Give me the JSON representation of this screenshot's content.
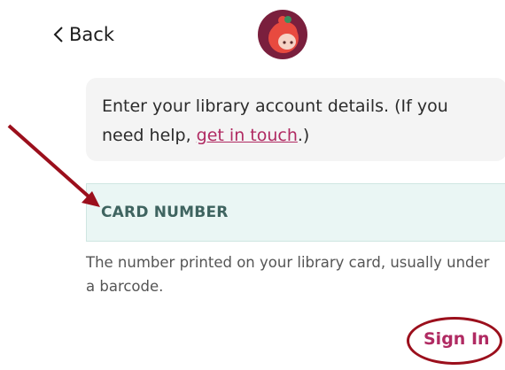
{
  "nav": {
    "back_label": "Back"
  },
  "icons": {
    "back": "chevron-left-icon",
    "logo": "libby-logo-icon"
  },
  "info": {
    "text_before": "Enter your library account details. (If you need help, ",
    "link_text": "get in touch",
    "text_after": ".)"
  },
  "form": {
    "card_number_label": "CARD NUMBER",
    "card_number_value": "",
    "hint": "The number printed on your library card, usually under a barcode."
  },
  "actions": {
    "sign_in_label": "Sign In"
  },
  "colors": {
    "accent": "#b02a62",
    "annotation": "#9b0f1c",
    "field_bg": "#eaf6f4",
    "info_bg": "#f4f4f4",
    "logo_bg": "#7a1f3d"
  }
}
